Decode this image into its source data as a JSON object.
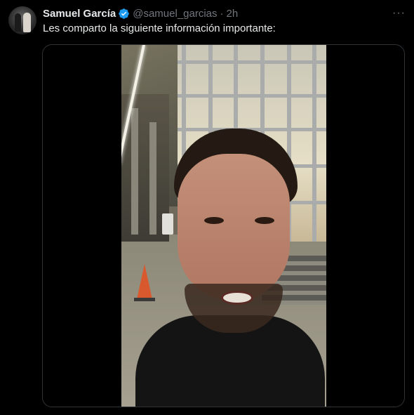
{
  "tweet": {
    "display_name": "Samuel García",
    "handle": "@samuel_garcias",
    "separator": "·",
    "time": "2h",
    "text": "Les comparto la siguiente información importante:",
    "more_label": "···"
  },
  "icons": {
    "verified": "verified-badge-icon",
    "more": "more-options-icon"
  },
  "colors": {
    "background": "#000000",
    "primary_text": "#e7e9ea",
    "secondary_text": "#71767b",
    "verified": "#1d9bf0",
    "border": "#2f3336"
  }
}
